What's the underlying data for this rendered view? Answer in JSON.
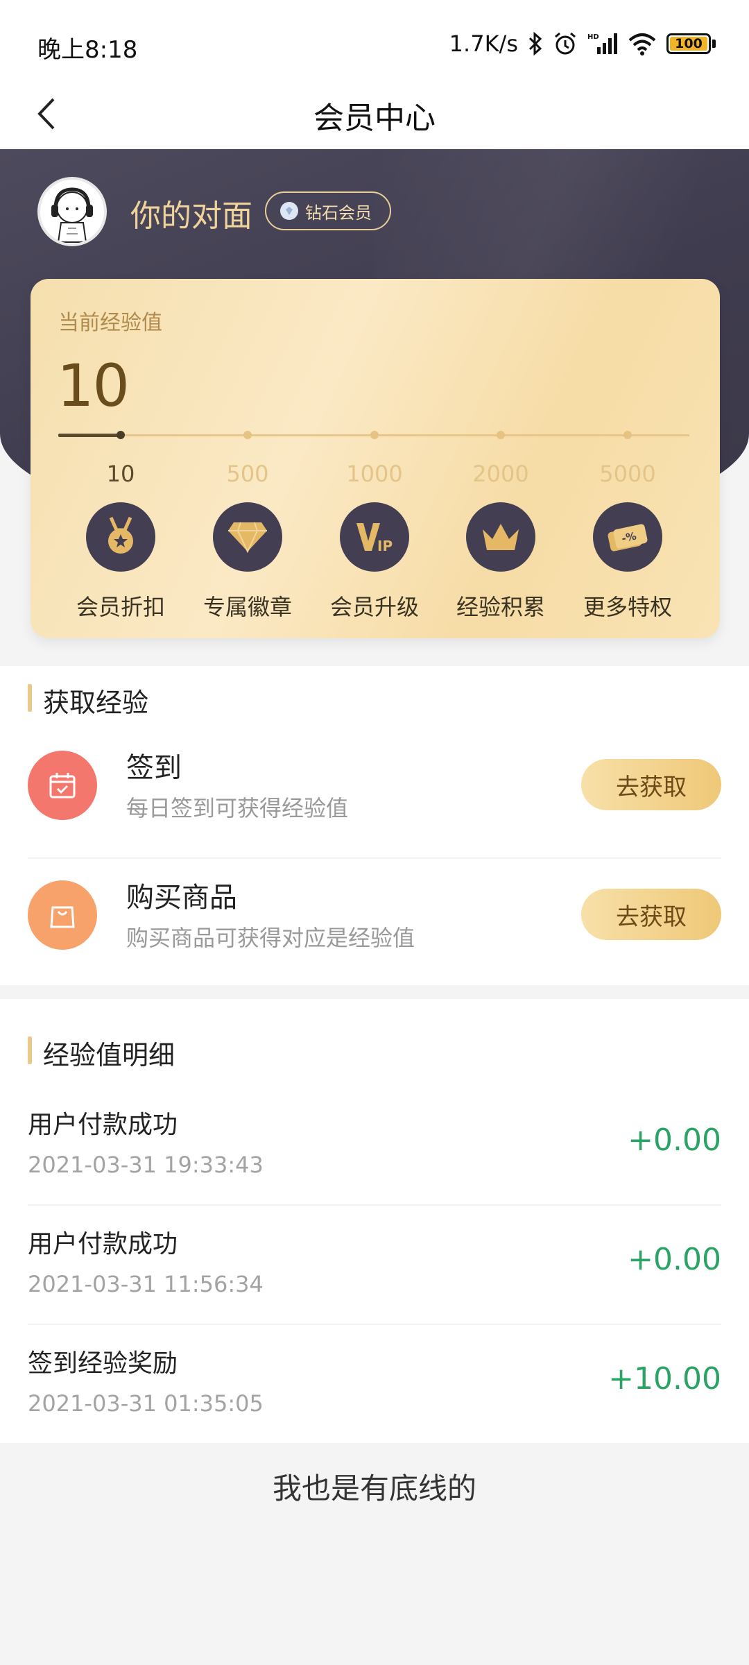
{
  "status_bar": {
    "time": "晚上8:18",
    "network_speed": "1.7K/s",
    "battery": "100",
    "icons": [
      "bluetooth-icon",
      "alarm-icon",
      "hd-signal-icon",
      "wifi-icon",
      "battery-icon"
    ]
  },
  "nav": {
    "title": "会员中心",
    "back_icon": "chevron-left-icon"
  },
  "user": {
    "name": "你的对面",
    "badge": "钻石会员"
  },
  "experience": {
    "label": "当前经验值",
    "value": "10",
    "progress_fraction": 0.1,
    "milestones": [
      "10",
      "500",
      "1000",
      "2000",
      "5000"
    ],
    "active_milestone_index": 0
  },
  "perks": [
    {
      "label": "会员折扣",
      "icon": "medal-icon"
    },
    {
      "label": "专属徽章",
      "icon": "diamond-icon"
    },
    {
      "label": "会员升级",
      "icon": "vip-icon"
    },
    {
      "label": "经验积累",
      "icon": "crown-icon"
    },
    {
      "label": "更多特权",
      "icon": "coupon-icon"
    }
  ],
  "earn_section": {
    "title": "获取经验",
    "tasks": [
      {
        "title": "签到",
        "desc": "每日签到可获得经验值",
        "button": "去获取",
        "icon": "calendar-icon",
        "color": "#f3776c"
      },
      {
        "title": "购买商品",
        "desc": "购买商品可获得对应是经验值",
        "button": "去获取",
        "icon": "shopping-bag-icon",
        "color": "#f7a26b"
      }
    ]
  },
  "detail_section": {
    "title": "经验值明细",
    "records": [
      {
        "title": "用户付款成功",
        "time": "2021-03-31 19:33:43",
        "amount": "+0.00"
      },
      {
        "title": "用户付款成功",
        "time": "2021-03-31 11:56:34",
        "amount": "+0.00"
      },
      {
        "title": "签到经验奖励",
        "time": "2021-03-31 01:35:05",
        "amount": "+10.00"
      }
    ]
  },
  "footer": {
    "text": "我也是有底线的"
  },
  "colors": {
    "header_bg": "#433e52",
    "gold": "#efc878",
    "amount_green": "#2ba364"
  }
}
